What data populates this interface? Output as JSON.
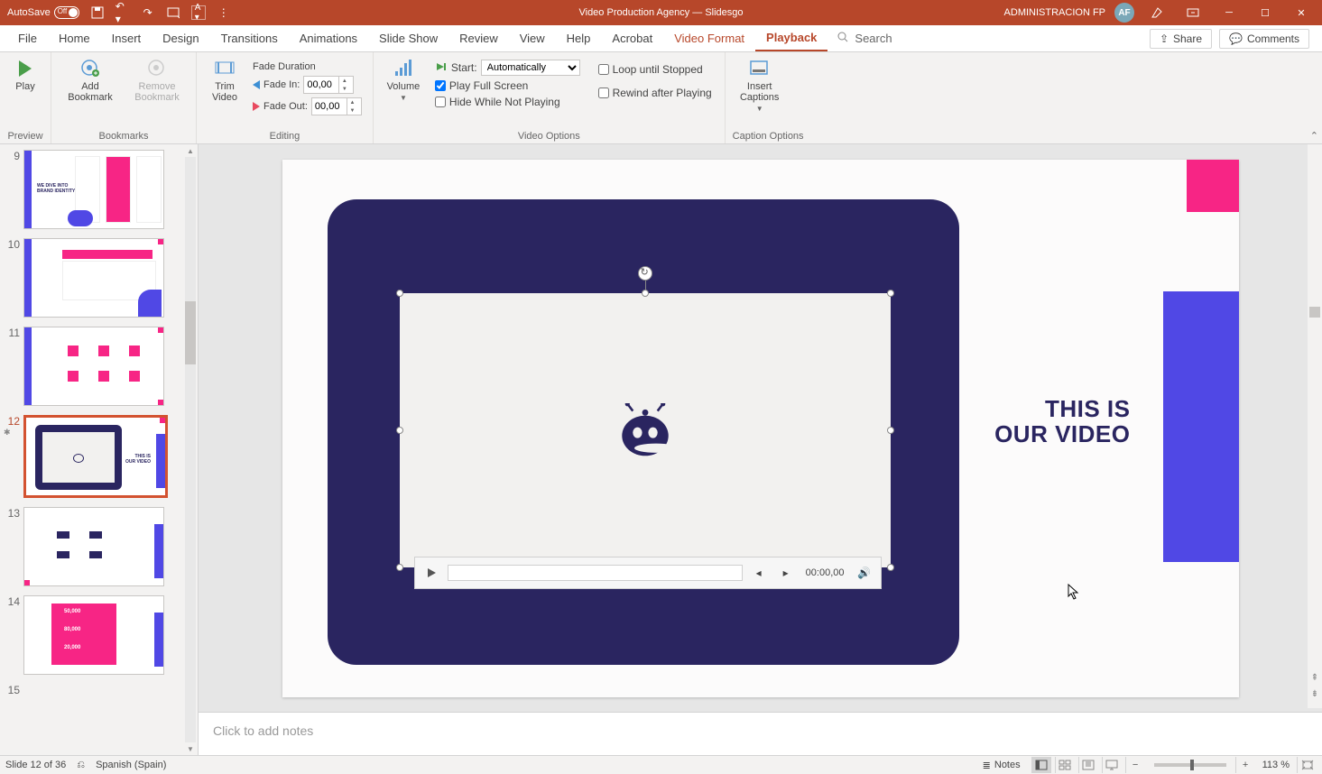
{
  "title_bar": {
    "autosave_label": "AutoSave",
    "autosave_state": "Off",
    "doc_title": "Video Production Agency — Slidesgo",
    "account": "ADMINISTRACION FP",
    "avatar_initials": "AF"
  },
  "menu": {
    "file": "File",
    "home": "Home",
    "insert": "Insert",
    "design": "Design",
    "transitions": "Transitions",
    "animations": "Animations",
    "slide_show": "Slide Show",
    "review": "Review",
    "view": "View",
    "help": "Help",
    "acrobat": "Acrobat",
    "video_format": "Video Format",
    "playback": "Playback",
    "search": "Search",
    "share": "Share",
    "comments": "Comments"
  },
  "ribbon": {
    "preview": {
      "play": "Play",
      "group": "Preview"
    },
    "bookmarks": {
      "add": "Add\nBookmark",
      "remove": "Remove\nBookmark",
      "group": "Bookmarks"
    },
    "editing": {
      "trim": "Trim\nVideo",
      "fade_title": "Fade Duration",
      "fade_in": "Fade In:",
      "fade_in_val": "00,00",
      "fade_out": "Fade Out:",
      "fade_out_val": "00,00",
      "group": "Editing"
    },
    "video_options": {
      "volume": "Volume",
      "start": "Start:",
      "start_value": "Automatically",
      "play_full": "Play Full Screen",
      "hide": "Hide While Not Playing",
      "loop": "Loop until Stopped",
      "rewind": "Rewind after Playing",
      "group": "Video Options"
    },
    "captions": {
      "insert": "Insert\nCaptions",
      "group": "Caption Options"
    }
  },
  "thumbnails": {
    "items": [
      {
        "num": "9"
      },
      {
        "num": "10"
      },
      {
        "num": "11"
      },
      {
        "num": "12"
      },
      {
        "num": "13"
      },
      {
        "num": "14"
      },
      {
        "num": "15"
      }
    ]
  },
  "slide": {
    "title_line1": "THIS IS",
    "title_line2": "OUR VIDEO",
    "video_time": "00:00,00"
  },
  "notes": {
    "placeholder": "Click to add notes"
  },
  "status": {
    "slide_count": "Slide 12 of 36",
    "language": "Spanish (Spain)",
    "notes_btn": "Notes",
    "zoom_pct": "113 %"
  }
}
